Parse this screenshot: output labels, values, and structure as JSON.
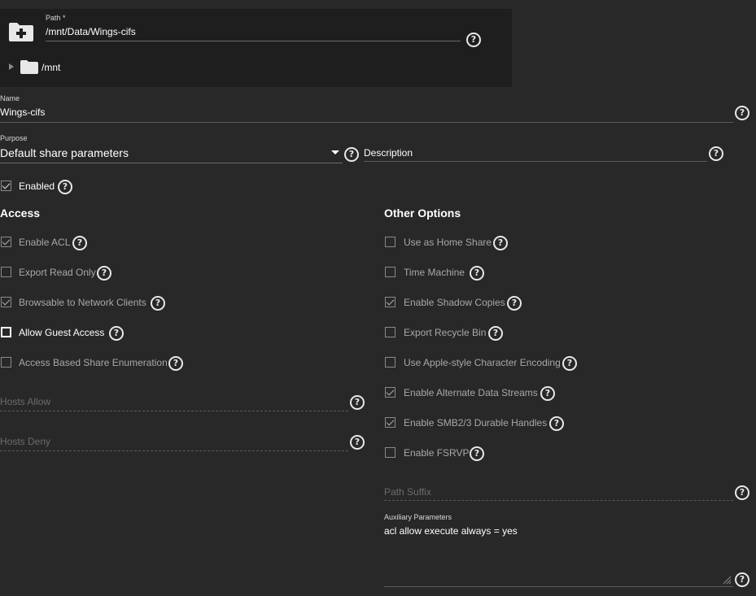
{
  "path_picker": {
    "label": "Path *",
    "value": "/mnt/Data/Wings-cifs",
    "tree_root": "/mnt"
  },
  "name": {
    "label": "Name",
    "value": "Wings-cifs"
  },
  "purpose": {
    "label": "Purpose",
    "value": "Default share parameters"
  },
  "description": {
    "placeholder": "Description"
  },
  "enabled": {
    "label": "Enabled",
    "checked": true
  },
  "access": {
    "title": "Access",
    "items": [
      {
        "label": "Enable ACL",
        "checked": true
      },
      {
        "label": "Export Read Only",
        "checked": false
      },
      {
        "label": "Browsable to Network Clients",
        "checked": true
      },
      {
        "label": "Allow Guest Access",
        "checked": false
      },
      {
        "label": "Access Based Share Enumeration",
        "checked": false
      }
    ],
    "hosts_allow_placeholder": "Hosts Allow",
    "hosts_deny_placeholder": "Hosts Deny"
  },
  "other": {
    "title": "Other Options",
    "items": [
      {
        "label": "Use as Home Share",
        "checked": false
      },
      {
        "label": "Time Machine",
        "checked": false
      },
      {
        "label": "Enable Shadow Copies",
        "checked": true
      },
      {
        "label": "Export Recycle Bin",
        "checked": false
      },
      {
        "label": "Use Apple-style Character Encoding",
        "checked": false
      },
      {
        "label": "Enable Alternate Data Streams",
        "checked": true
      },
      {
        "label": "Enable SMB2/3 Durable Handles",
        "checked": true
      },
      {
        "label": "Enable FSRVP",
        "checked": false
      }
    ],
    "path_suffix_placeholder": "Path Suffix",
    "aux": {
      "label": "Auxiliary Parameters",
      "value": "acl allow execute always = yes"
    }
  }
}
